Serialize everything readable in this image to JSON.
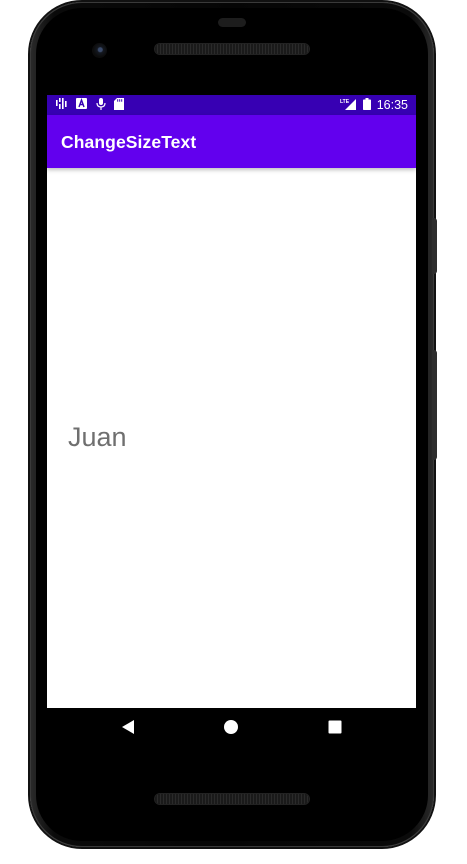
{
  "status_bar": {
    "time": "16:35",
    "left_icons": [
      "signal-bars-icon",
      "text-a-icon",
      "microphone-icon",
      "sd-card-icon"
    ],
    "right_icons": [
      "lte-signal-icon",
      "battery-icon"
    ],
    "background_color": "#3700b3"
  },
  "app_bar": {
    "title": "ChangeSizeText",
    "background_color": "#6200ee"
  },
  "main": {
    "text": "Juan",
    "text_color": "#6f6f6f"
  },
  "nav_bar": {
    "buttons": [
      "back-icon",
      "home-icon",
      "recents-icon"
    ]
  }
}
